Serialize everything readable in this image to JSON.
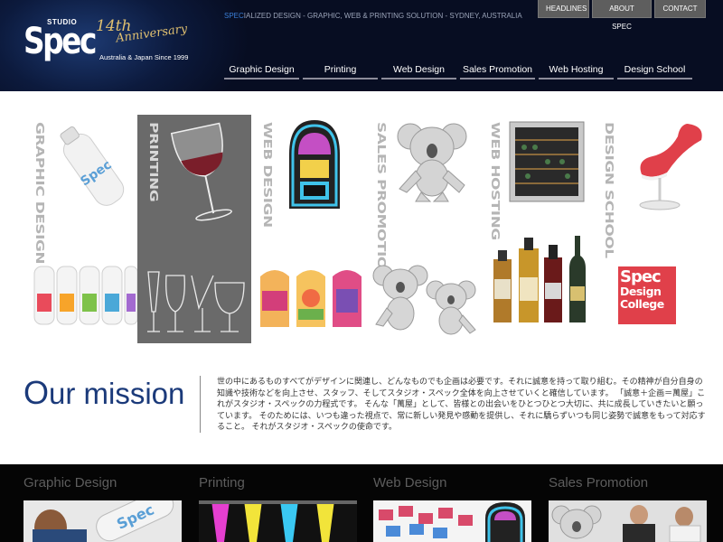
{
  "header": {
    "logo": {
      "studio": "STUDIO",
      "brand": "Spec",
      "anniversary": "14th",
      "anniversary_sub": "Anniversary",
      "since": "Australia & Japan Since 1999"
    },
    "tagline_highlight": "SPEC",
    "tagline_rest": "IALIZED DESIGN - GRAPHIC, WEB & PRINTING SOLUTION - SYDNEY, AUSTRALIA",
    "top_nav": [
      "HEADLINES",
      "ABOUT SPEC",
      "CONTACT"
    ],
    "main_nav": [
      "Graphic Design",
      "Printing",
      "Web Design",
      "Sales Promotion",
      "Web Hosting",
      "Design School"
    ]
  },
  "gallery": {
    "columns": [
      {
        "label": "GRAPHIC DESIGN",
        "image_top": "spec-bottle",
        "image_bottom": "colored-bottles"
      },
      {
        "label": "PRINTING",
        "image_top": "wine-glass",
        "image_bottom": "glasses-outline"
      },
      {
        "label": "WEB DESIGN",
        "image_top": "jukebox",
        "image_bottom": "label-cards"
      },
      {
        "label": "SALES PROMOTION",
        "image_top": "koala-statue",
        "image_bottom": "koala-statues"
      },
      {
        "label": "WEB HOSTING",
        "image_top": "wine-fridge",
        "image_bottom": "liquor-bottles"
      },
      {
        "label": "DESIGN SCHOOL",
        "image_top": "red-chair",
        "image_bottom": "spec-design-college"
      }
    ],
    "college_logo": {
      "line1": "Spec",
      "line2": "Design",
      "line3": "College"
    },
    "bottle_text": "Spec"
  },
  "mission": {
    "title_first": "O",
    "title_rest": "ur mission",
    "text": "世の中にあるものすべてがデザインに関連し、どんなものでも企画は必要です。それに誠意を持って取り組む。その精神が自分自身の知識や技術などを向上させ、スタッフ、そしてスタジオ・スペック全体を向上させていくと確信しています。 「誠意＋企画＝萬屋」これがスタジオ・スペックの力程式です。 そんな「萬屋」として、皆様との出会いをひとつひとつ大切に、共に成長していきたいと願っています。 そのためには、いつも違った視点で、常に新しい発見や感動を提供し、それに驕らずいつも同じ姿勢で誠意をもって対応すること。 それがスタジオ・スペックの使命です。"
  },
  "bottom_cards": [
    {
      "title": "Graphic Design"
    },
    {
      "title": "Printing"
    },
    {
      "title": "Web Design"
    },
    {
      "title": "Sales Promotion"
    }
  ],
  "colors": {
    "header_bg": "#0c1a3d",
    "accent_blue": "#1b3a7a",
    "highlight_col": "#6a6a6a",
    "bottom_bg": "#050505"
  }
}
